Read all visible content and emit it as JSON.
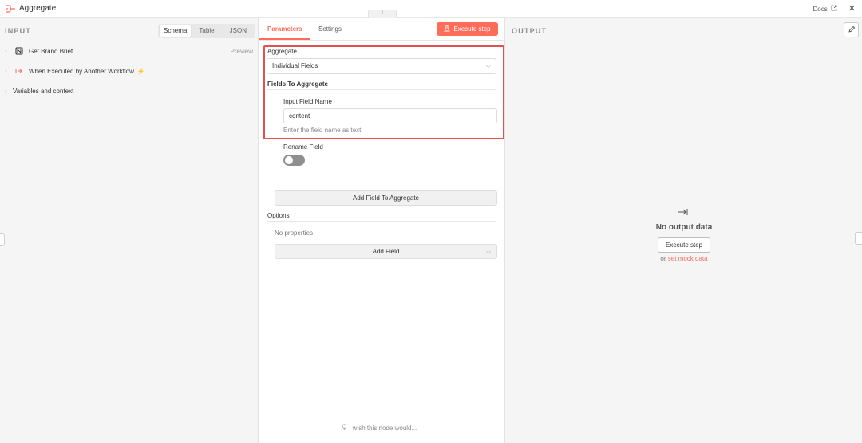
{
  "header": {
    "title": "Aggregate",
    "docs_label": "Docs",
    "close_glyph": "✕",
    "handle_glyph": "⦀",
    "icons": {
      "node": "aggregate-icon",
      "external": "external-link-icon",
      "close": "close-icon"
    }
  },
  "input_panel": {
    "heading": "INPUT",
    "view_tabs": [
      "Schema",
      "Table",
      "JSON"
    ],
    "active_view": "Schema",
    "preview_label": "Preview",
    "nodes": [
      {
        "label": "Get Brand Brief",
        "icon": "notion-icon"
      },
      {
        "label": "When Executed by Another Workflow",
        "icon": "workflow-trigger-icon",
        "badge": "⚡"
      }
    ],
    "variables_label": "Variables and context"
  },
  "parameters": {
    "tabs": [
      "Parameters",
      "Settings"
    ],
    "active_tab": "Parameters",
    "execute_label": "Execute step",
    "aggregate_label": "Aggregate",
    "aggregate_value": "Individual Fields",
    "fields_label": "Fields To Aggregate",
    "input_field_label": "Input Field Name",
    "input_field_value": "content",
    "input_field_hint": "Enter the field name as text",
    "rename_label": "Rename Field",
    "rename_enabled": false,
    "add_field_to_aggregate": "Add Field To Aggregate",
    "options_label": "Options",
    "no_properties": "No properties",
    "add_field_label": "Add Field",
    "wish_text": "I wish this node would..."
  },
  "output_panel": {
    "heading": "OUTPUT",
    "empty_title": "No output data",
    "execute_label": "Execute step",
    "or_text": "or",
    "mock_link": "set mock data"
  },
  "colors": {
    "accent": "#ff6d5a",
    "highlight_border": "#e25050"
  }
}
